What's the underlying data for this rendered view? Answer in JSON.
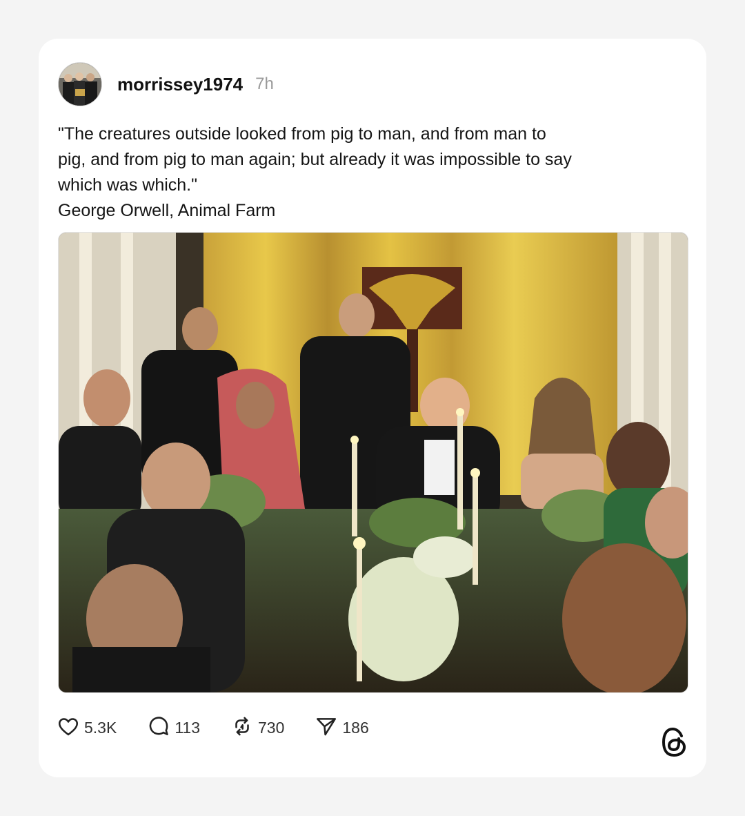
{
  "post": {
    "username": "morrissey1974",
    "time_ago": "7h",
    "text_lines": [
      "\"The creatures outside looked from pig to man, and from man to",
      "pig, and from pig to man again; but already it was impossible to say",
      "which was which.\""
    ],
    "attribution": "George Orwell, Animal Farm"
  },
  "actions": {
    "likes": "5.3K",
    "replies": "113",
    "reposts": "730",
    "shares": "186"
  },
  "icons": {
    "like": "heart-icon",
    "reply": "speech-bubble-icon",
    "repost": "repost-icon",
    "share": "paper-plane-icon",
    "brand": "threads-logo-icon"
  },
  "colors": {
    "page_bg": "#f4f4f4",
    "card_bg": "#ffffff",
    "text": "#111111",
    "muted": "#9a9a9a"
  }
}
